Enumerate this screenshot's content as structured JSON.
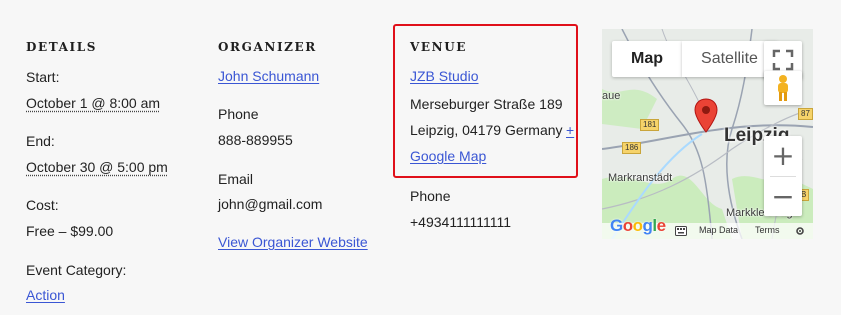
{
  "details": {
    "heading": "DETAILS",
    "start_label": "Start:",
    "start_value": "October 1 @ 8:00 am",
    "end_label": "End:",
    "end_value": "October 30 @ 5:00 pm",
    "cost_label": "Cost:",
    "cost_value": "Free – $99.00",
    "category_label": "Event Category:",
    "category_value": "Action"
  },
  "organizer": {
    "heading": "ORGANIZER",
    "name": "John Schumann",
    "phone_label": "Phone",
    "phone_value": "888-889955",
    "email_label": "Email",
    "email_value": "john@gmail.com",
    "website_link": "View Organizer Website"
  },
  "venue": {
    "heading": "VENUE",
    "name": "JZB Studio",
    "street": "Merseburger Straße 189",
    "city_line": "Leipzig, 04179 Germany",
    "map_link_plus": "+",
    "map_link_text": "Google Map",
    "phone_label": "Phone",
    "phone_value": "+4934111111111"
  },
  "map": {
    "tab_map": "Map",
    "tab_satellite": "Satellite",
    "city_main": "Leipzig",
    "place_markranstadt": "Markranstädt",
    "place_markkleeberg": "Markkleeberg",
    "place_aue": "aue",
    "road_181": "181",
    "road_186": "186",
    "road_87": "87",
    "road_b": "B",
    "google_logo": "Google",
    "map_data": "Map Data",
    "terms": "Terms",
    "zoom_in": "+",
    "zoom_out": "−",
    "colors": {
      "pin": "#ea4335",
      "water": "#aadaff",
      "green": "#c3ecb2"
    }
  }
}
